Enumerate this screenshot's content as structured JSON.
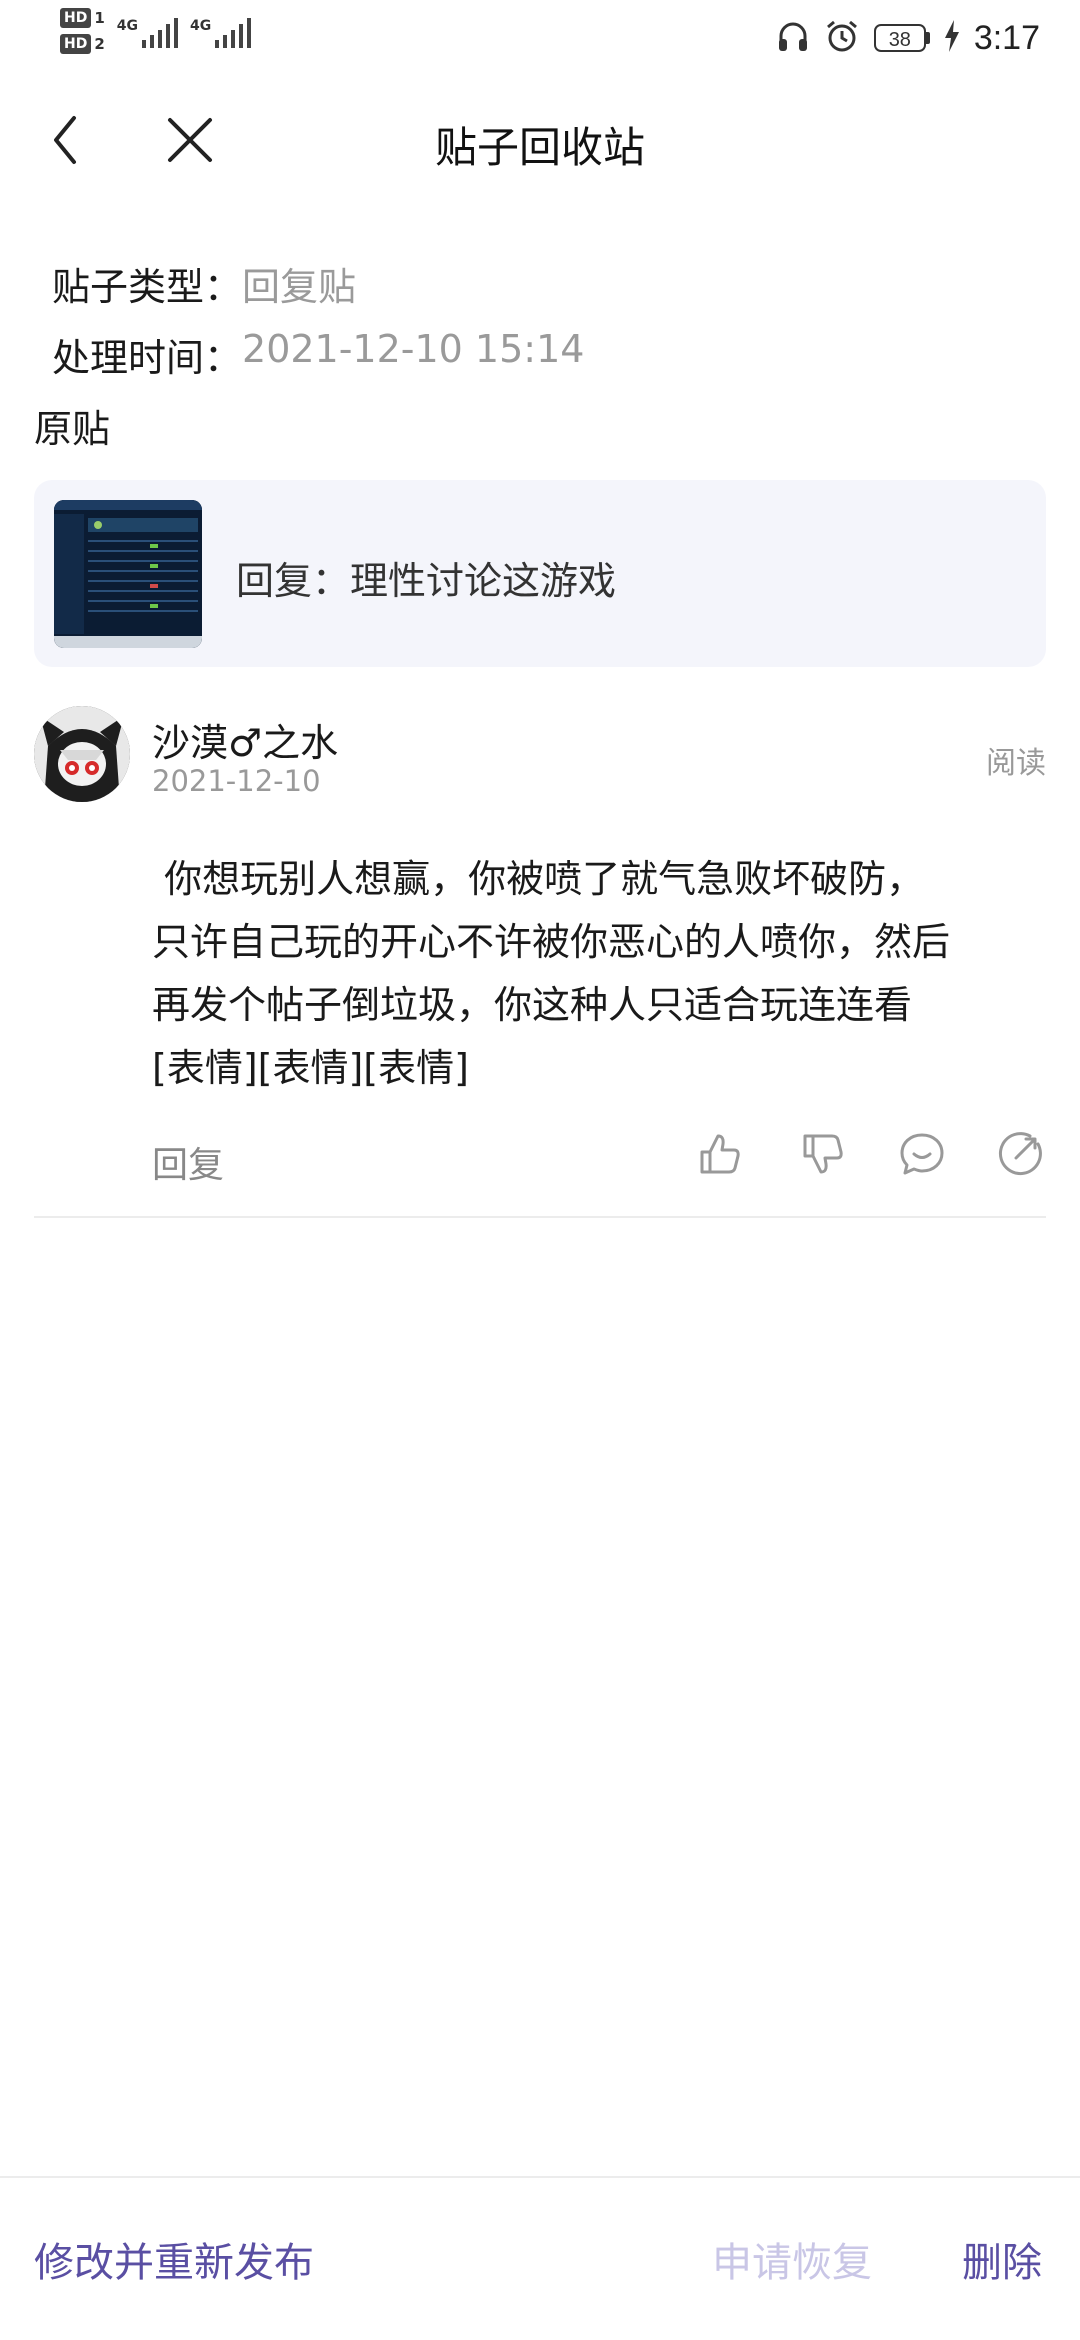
{
  "status_bar": {
    "hd1": "HD",
    "hd1_num": "1",
    "hd2": "HD",
    "hd2_num": "2",
    "sig1": "4G",
    "sig2": "4G",
    "battery": "38",
    "time": "3:17"
  },
  "nav": {
    "title": "贴子回收站"
  },
  "meta": {
    "type_label": "贴子类型：",
    "type_value": "回复贴",
    "time_label": "处理时间：",
    "time_value": "2021-12-10 15:14"
  },
  "section": {
    "original": "原贴"
  },
  "original_post": {
    "text": "回复：理性讨论这游戏"
  },
  "comment": {
    "username": "沙漠♂之水",
    "date": "2021-12-10",
    "read": "阅读",
    "body": " 你想玩别人想赢，你被喷了就气急败坏破防，\n只许自己玩的开心不许被你恶心的人喷你，然后\n再发个帖子倒垃圾，你这种人只适合玩连连看\n[表情][表情][表情]",
    "reply": "回复"
  },
  "bottom": {
    "republish": "修改并重新发布",
    "restore": "申请恢复",
    "delete": "删除"
  },
  "colors": {
    "accent": "#5a4fa3",
    "disabled": "#c9c6e6",
    "card_bg": "#f4f5fb",
    "muted": "#999999"
  }
}
